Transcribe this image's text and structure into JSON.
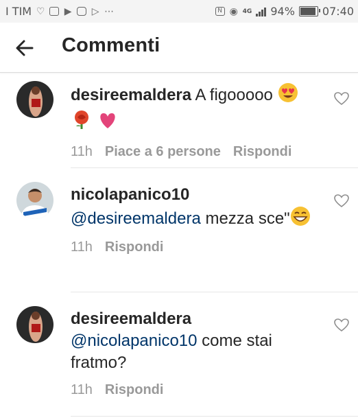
{
  "status_bar": {
    "carrier": "I TIM",
    "network": "4G",
    "battery": "94%",
    "time": "07:40",
    "left_icons": [
      "heart-rate-icon",
      "gallery-icon",
      "youtube-icon",
      "instagram-icon",
      "play-store-icon",
      "more-icon"
    ],
    "right_icons": [
      "nfc-icon",
      "eye-icon",
      "signal-icon",
      "battery-icon"
    ]
  },
  "header": {
    "title": "Commenti",
    "back_icon": "arrow-left-icon"
  },
  "comments": [
    {
      "username": "desireemaldera",
      "text": "A figooooo",
      "emojis": [
        "heart-eyes-emoji",
        "rose-emoji",
        "pink-heart-emoji"
      ],
      "time": "11h",
      "likes": "Piace a 6 persone",
      "reply": "Rispondi"
    },
    {
      "username": "nicolapanico10",
      "mention": "@desireemaldera",
      "text": " mezza sce\"",
      "emojis": [
        "grinning-emoji"
      ],
      "time": "11h",
      "reply": "Rispondi"
    },
    {
      "username": "desireemaldera",
      "mention": "@nicolapanico10",
      "text": " come stai fratmo?",
      "time": "11h",
      "reply": "Rispondi"
    }
  ],
  "colors": {
    "text": "#262626",
    "meta": "#999999",
    "mention": "#003569",
    "divider": "#e6e6e6"
  }
}
